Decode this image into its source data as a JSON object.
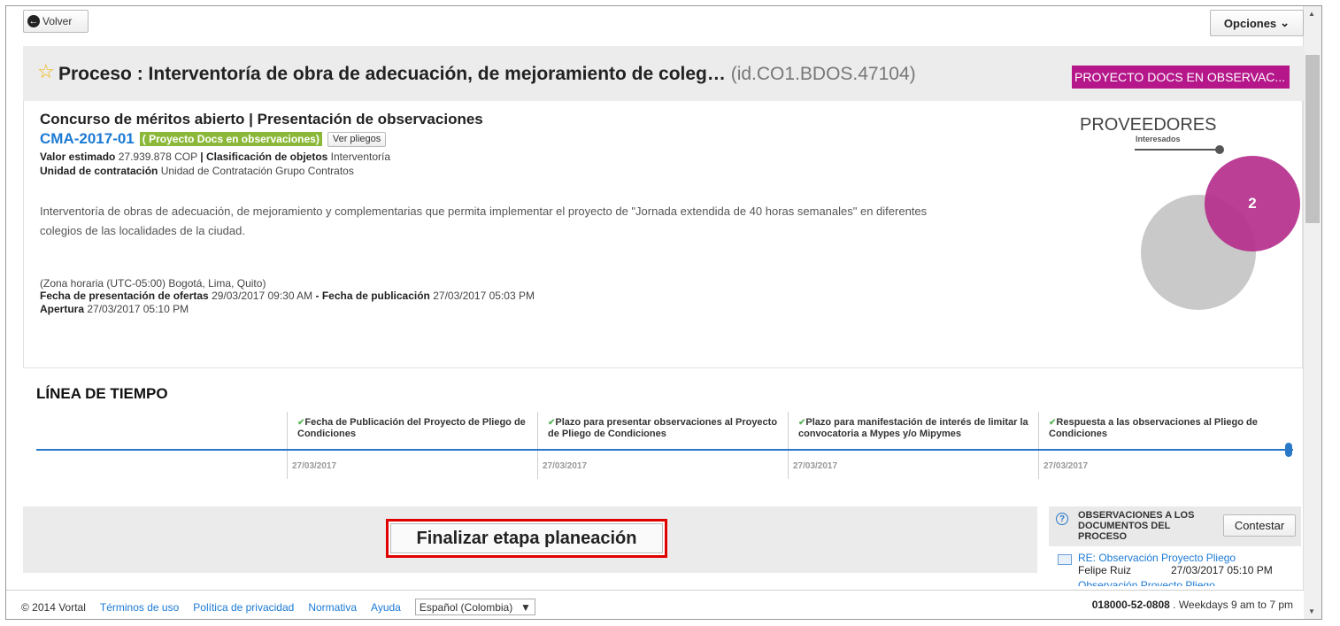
{
  "top": {
    "back_label": "Volver",
    "options_label": "Opciones"
  },
  "header": {
    "title": "Proceso : Interventoría de obra de adecuación, de mejoramiento de coleg…",
    "id": "(id.CO1.BDOS.47104)",
    "status_tag": "PROYECTO DOCS EN OBSERVAC..."
  },
  "summary": {
    "type_title": "Concurso de méritos abierto | Presentación de observaciones",
    "ref_code": "CMA-2017-01",
    "ref_badge": "( Proyecto Docs en observaciones)",
    "ver_pliegos": "Ver pliegos",
    "valor_label": "Valor estimado",
    "valor": "27.939.878 COP",
    "sep": "|",
    "clasif_label": "Clasificación de objetos",
    "clasif": "Interventoría",
    "unidad_label": "Unidad de contratación",
    "unidad": "Unidad de Contratación Grupo Contratos",
    "description": "Interventoría de obras de adecuación, de mejoramiento y complementarias que permita implementar el proyecto de \"Jornada extendida de 40 horas semanales\" en diferentes colegios de las localidades de la ciudad.",
    "timezone": "(Zona horaria (UTC-05:00) Bogotá, Lima, Quito)",
    "fecha_ofertas_label": "Fecha de presentación de ofertas",
    "fecha_ofertas": "29/03/2017 09:30 AM",
    "fecha_pub_label": "- Fecha de publicación",
    "fecha_pub": "27/03/2017 05:03 PM",
    "apertura_label": "Apertura",
    "apertura": "27/03/2017 05:10 PM"
  },
  "proveedores": {
    "title": "PROVEEDORES",
    "subtitle": "Interesados",
    "count": "2"
  },
  "timeline": {
    "title": "LÍNEA DE TIEMPO",
    "events": [
      {
        "label": "Fecha de Publicación del Proyecto de Pliego de Condiciones",
        "date": "27/03/2017"
      },
      {
        "label": "Plazo para presentar observaciones al Proyecto de Pliego de Condiciones",
        "date": "27/03/2017"
      },
      {
        "label": "Plazo para manifestación de interés de limitar la convocatoria a Mypes y/o Mipymes",
        "date": "27/03/2017"
      },
      {
        "label": "Respuesta a las observaciones al Pliego de Condiciones",
        "date": "27/03/2017"
      }
    ]
  },
  "action": {
    "finalize_label": "Finalizar etapa planeación"
  },
  "observations": {
    "title": "OBSERVACIONES A LOS DOCUMENTOS DEL PROCESO",
    "reply_label": "Contestar",
    "message": {
      "subject": "RE: Observación Proyecto Pliego",
      "author": "Felipe Ruiz",
      "date": "27/03/2017 05:10 PM"
    },
    "next_subject": "Observación Proyecto Pliego"
  },
  "footer": {
    "copyright": "© 2014 Vortal",
    "links": [
      "Términos de uso",
      "Política de privacidad",
      "Normativa",
      "Ayuda"
    ],
    "language": "Español (Colombia)",
    "phone": "018000-52-0808",
    "hours": ". Weekdays 9 am to 7 pm"
  }
}
